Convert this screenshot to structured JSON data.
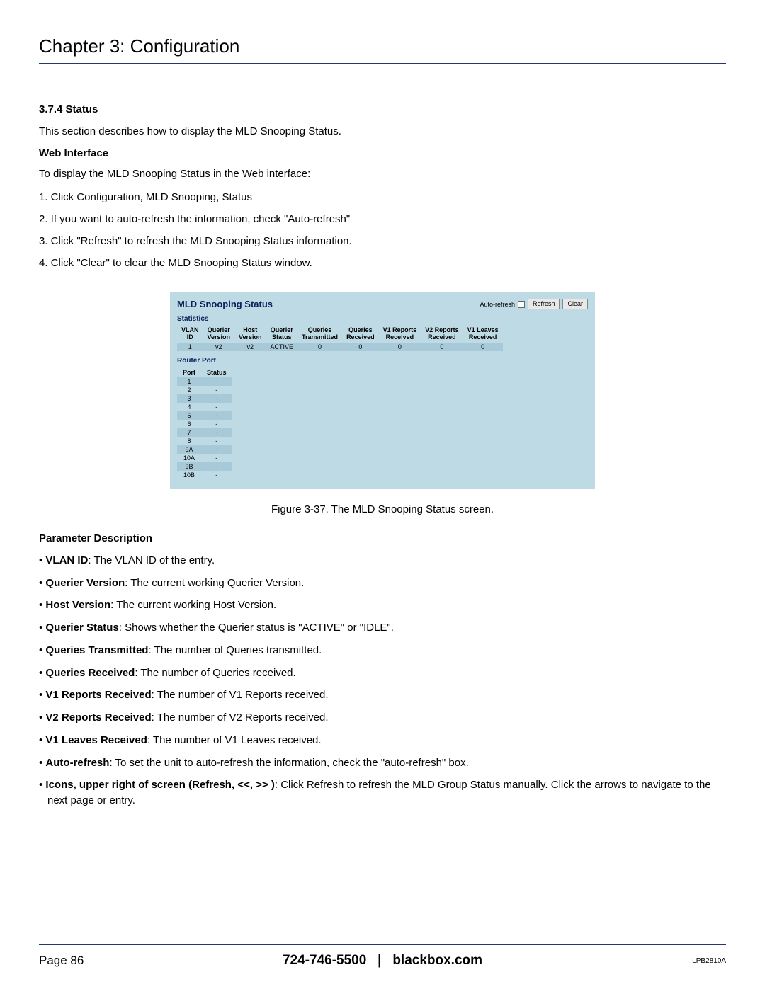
{
  "chapter_title": "Chapter 3: Configuration",
  "section": {
    "number_title": "3.7.4 Status",
    "intro": "This section describes how to display the MLD Snooping Status.",
    "web_interface_heading": "Web Interface",
    "web_interface_intro": "To display the MLD Snooping Status in the Web interface:",
    "steps": [
      "1. Click Configuration, MLD Snooping, Status",
      "2. If you want to auto-refresh the information, check \"Auto-refresh\"",
      "3. Click \"Refresh\" to refresh the MLD Snooping Status information.",
      "4. Click \"Clear\" to clear the MLD Snooping Status window."
    ]
  },
  "screenshot": {
    "title": "MLD Snooping Status",
    "auto_refresh_label": "Auto-refresh",
    "refresh_btn": "Refresh",
    "clear_btn": "Clear",
    "statistics_label": "Statistics",
    "stats_headers": [
      "VLAN\nID",
      "Querier\nVersion",
      "Host\nVersion",
      "Querier\nStatus",
      "Queries\nTransmitted",
      "Queries\nReceived",
      "V1 Reports\nReceived",
      "V2 Reports\nReceived",
      "V1 Leaves\nReceived"
    ],
    "stats_row": [
      "1",
      "v2",
      "v2",
      "ACTIVE",
      "0",
      "0",
      "0",
      "0",
      "0"
    ],
    "router_port_label": "Router Port",
    "router_headers": [
      "Port",
      "Status"
    ],
    "router_rows": [
      [
        "1",
        "-"
      ],
      [
        "2",
        "-"
      ],
      [
        "3",
        "-"
      ],
      [
        "4",
        "-"
      ],
      [
        "5",
        "-"
      ],
      [
        "6",
        "-"
      ],
      [
        "7",
        "-"
      ],
      [
        "8",
        "-"
      ],
      [
        "9A",
        "-"
      ],
      [
        "10A",
        "-"
      ],
      [
        "9B",
        "-"
      ],
      [
        "10B",
        "-"
      ]
    ]
  },
  "figure_caption": "Figure 3-37. The MLD Snooping Status screen.",
  "param_heading": "Parameter Description",
  "params": [
    {
      "term": "VLAN ID",
      "desc": ": The VLAN ID of the entry."
    },
    {
      "term": "Querier Version",
      "desc": ": The current working Querier Version."
    },
    {
      "term": "Host Version",
      "desc": ": The current working Host Version."
    },
    {
      "term": "Querier Status",
      "desc": ": Shows whether the Querier status is \"ACTIVE\" or \"IDLE\"."
    },
    {
      "term": "Queries Transmitted",
      "desc": ": The number of Queries transmitted."
    },
    {
      "term": "Queries Received",
      "desc": ": The number of Queries received."
    },
    {
      "term": "V1 Reports Received",
      "desc": ": The number of V1 Reports received."
    },
    {
      "term": "V2 Reports Received",
      "desc": ": The number of V2 Reports received."
    },
    {
      "term": "V1 Leaves Received",
      "desc": ": The number of V1 Leaves received."
    },
    {
      "term": "Auto-refresh",
      "desc": ": To set the unit to auto-refresh the information, check the \"auto-refresh\" box."
    },
    {
      "term": "Icons, upper right of screen (Refresh, <<, >> )",
      "desc": ": Click Refresh to refresh the MLD Group Status manually. Click the arrows to navigate to the next page or entry."
    }
  ],
  "footer": {
    "page": "Page 86",
    "phone": "724-746-5500",
    "sep": "|",
    "site": "blackbox.com",
    "model": "LPB2810A"
  }
}
